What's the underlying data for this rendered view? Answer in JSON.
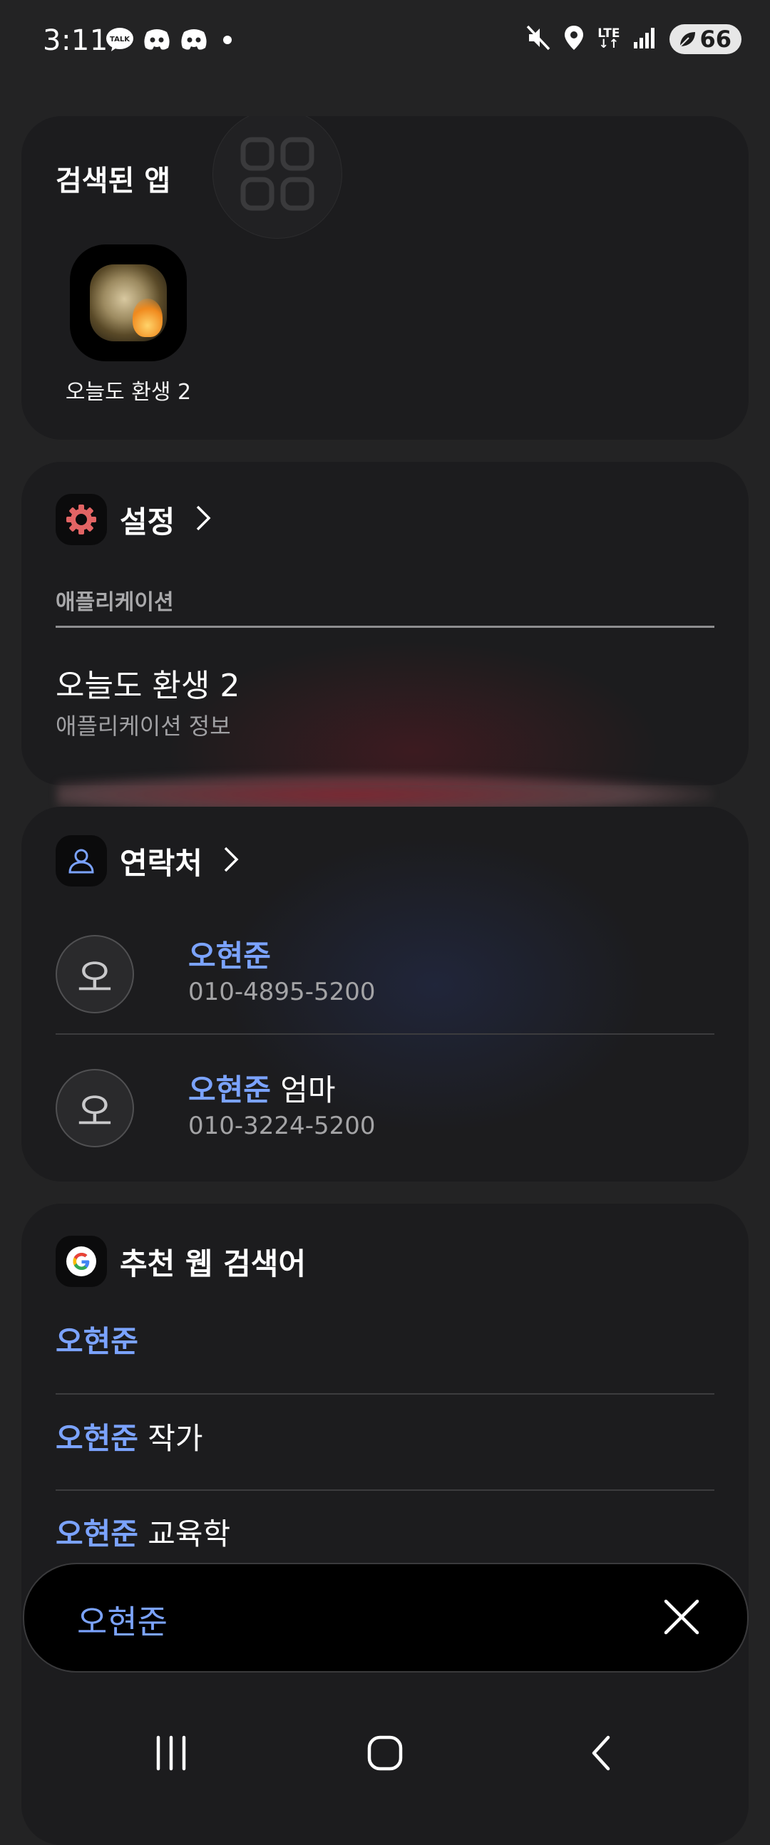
{
  "status_bar": {
    "time": "3:11",
    "left_icons": [
      "kakaotalk-icon",
      "discord-icon",
      "discord-icon",
      "dot-icon"
    ],
    "network": "LTE",
    "battery": "66"
  },
  "apps_card": {
    "title": "검색된 앱",
    "app": {
      "label": "오늘도 환생 2",
      "icon": "game-app-icon"
    }
  },
  "settings_card": {
    "title": "설정",
    "subheader": "애플리케이션",
    "result_title": "오늘도 환생 2",
    "result_subtitle": "애플리케이션 정보",
    "accent": "#e26464"
  },
  "contacts_card": {
    "title": "연락처",
    "contacts": [
      {
        "avatar": "오",
        "name_highlight": "오현준",
        "name_rest": "",
        "phone": "010-4895-5200"
      },
      {
        "avatar": "오",
        "name_highlight": "오현준",
        "name_rest": " 엄마",
        "phone": "010-3224-5200"
      }
    ]
  },
  "web_card": {
    "title": "추천 웹 검색어",
    "items": [
      {
        "highlight": "오현준",
        "rest": ""
      },
      {
        "highlight": "오현준",
        "rest": " 작가"
      },
      {
        "highlight": "오현준",
        "rest": " 교육학"
      }
    ]
  },
  "search": {
    "query": "오현준"
  },
  "nav": [
    "recents-icon",
    "home-icon",
    "back-icon"
  ],
  "colors": {
    "highlight": "#7ba3ff",
    "card_bg": "#1c1c1e",
    "page_bg": "#232324"
  }
}
